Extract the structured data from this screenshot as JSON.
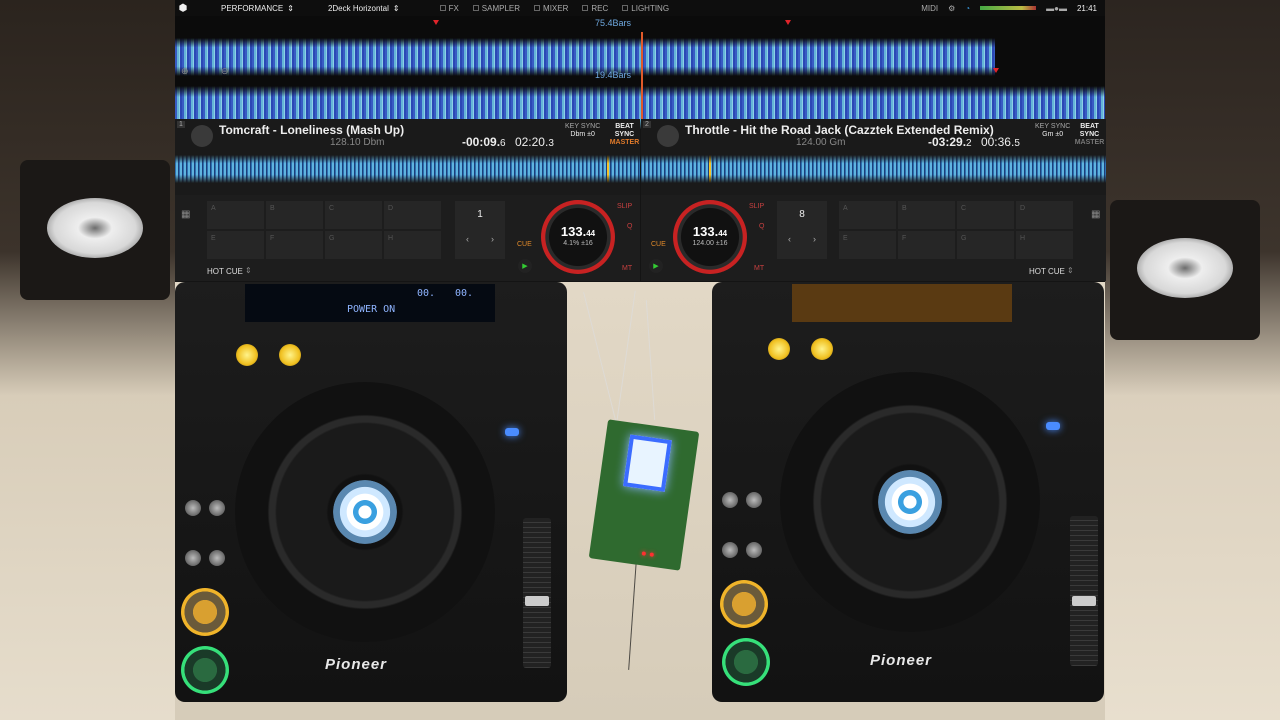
{
  "topbar": {
    "mode": "PERFORMANCE",
    "layout": "2Deck Horizontal",
    "checks": [
      "FX",
      "SAMPLER",
      "MIXER",
      "REC",
      "LIGHTING"
    ],
    "midi": "MIDI",
    "clock": "21:41"
  },
  "overview": {
    "bars_top": "75.4Bars",
    "bars_bottom": "19.4Bars"
  },
  "decks": [
    {
      "number": "1",
      "title": "Tomcraft - Loneliness (Mash Up)",
      "bpm_key": "128.10 Dbm",
      "remaining": "-00:09.",
      "remaining_frac": "6",
      "elapsed": "02:20.",
      "elapsed_frac": "3",
      "key_label": "KEY SYNC",
      "key_value": "Dbm ±0",
      "beat_sync": "BEAT SYNC",
      "master": "MASTER",
      "loop_value": "1",
      "platter_bpm": "133.",
      "platter_bpm_frac": "44",
      "platter_sub": "4.1%  ±16",
      "slip": "SLIP",
      "q": "Q",
      "cue": "CUE",
      "mt": "MT",
      "hot_cue": "HOT CUE",
      "pads": [
        "A",
        "B",
        "C",
        "D",
        "E",
        "F",
        "G",
        "H"
      ]
    },
    {
      "number": "2",
      "title": "Throttle - Hit the Road Jack (Cazztek Extended Remix)",
      "bpm_key": "124.00 Gm",
      "remaining": "-03:29.",
      "remaining_frac": "2",
      "elapsed": "00:36.",
      "elapsed_frac": "5",
      "key_label": "KEY SYNC",
      "key_value": "Gm ±0",
      "beat_sync": "BEAT SYNC",
      "master": "MASTER",
      "loop_value": "8",
      "platter_bpm": "133.",
      "platter_bpm_frac": "44",
      "platter_sub": "124.00  ±16",
      "slip": "SLIP",
      "q": "Q",
      "cue": "CUE",
      "mt": "MT",
      "hot_cue": "HOT CUE",
      "pads": [
        "A",
        "B",
        "C",
        "D",
        "E",
        "F",
        "G",
        "H"
      ]
    }
  ],
  "hardware": {
    "lcd_status": "POWER ON",
    "lcd_time_a": "00.",
    "lcd_time_b": "00.",
    "brand": "Pioneer"
  },
  "colors": {
    "accent_orange": "#e05a2a",
    "waveform_blue": "#3d64d8",
    "waveform_cyan": "#6fc8ef",
    "platter_red": "#c82222",
    "play_green": "#36e07a",
    "cue_yellow": "#f0c020"
  }
}
